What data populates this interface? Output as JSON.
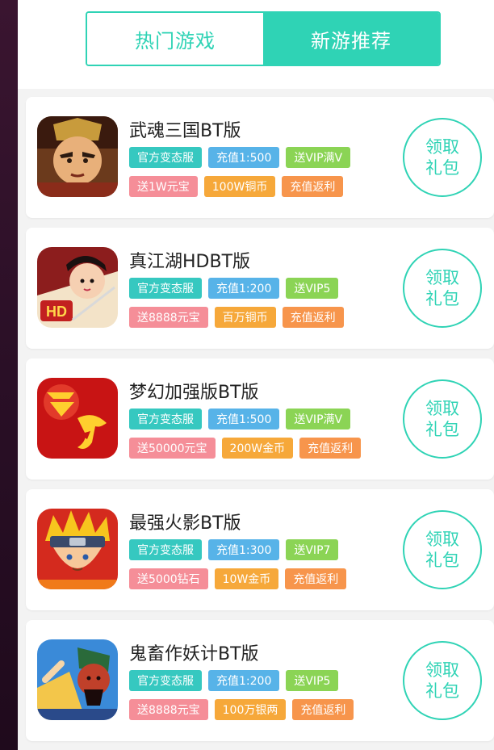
{
  "tabs": [
    {
      "label": "热门游戏",
      "active": false
    },
    {
      "label": "新游推荐",
      "active": true
    }
  ],
  "colors": {
    "accent": "#2fd3b5",
    "tag_teal": "#36c8c0",
    "tag_blue": "#57b3e8",
    "tag_green": "#8bd455",
    "tag_pink": "#f58e98",
    "tag_orange": "#f6a83a",
    "tag_salmon": "#f7954c"
  },
  "games": [
    {
      "title": "武魂三国BT版",
      "icon": "warrior-portrait-icon",
      "row1": [
        "官方变态服",
        "充值1:500",
        "送VIP满V"
      ],
      "row2": [
        "送1W元宝",
        "100W铜币",
        "充值返利"
      ],
      "button": [
        "领取",
        "礼包"
      ]
    },
    {
      "title": "真江湖HDBT版",
      "icon": "swordswoman-hd-icon",
      "row1": [
        "官方变态服",
        "充值1:200",
        "送VIP5"
      ],
      "row2": [
        "送8888元宝",
        "百万铜币",
        "充值返利"
      ],
      "button": [
        "领取",
        "礼包"
      ]
    },
    {
      "title": "梦幻加强版BT版",
      "icon": "menghuan-calligraphy-icon",
      "row1": [
        "官方变态服",
        "充值1:500",
        "送VIP满V"
      ],
      "row2": [
        "送50000元宝",
        "200W金币",
        "充值返利"
      ],
      "button": [
        "领取",
        "礼包"
      ]
    },
    {
      "title": "最强火影BT版",
      "icon": "ninja-portrait-icon",
      "row1": [
        "官方变态服",
        "充值1:300",
        "送VIP7"
      ],
      "row2": [
        "送5000钻石",
        "10W金币",
        "充值返利"
      ],
      "button": [
        "领取",
        "礼包"
      ]
    },
    {
      "title": "鬼畜作妖计BT版",
      "icon": "general-portrait-icon",
      "row1": [
        "官方变态服",
        "充值1:200",
        "送VIP5"
      ],
      "row2": [
        "送8888元宝",
        "100万银两",
        "充值返利"
      ],
      "button": [
        "领取",
        "礼包"
      ]
    }
  ]
}
